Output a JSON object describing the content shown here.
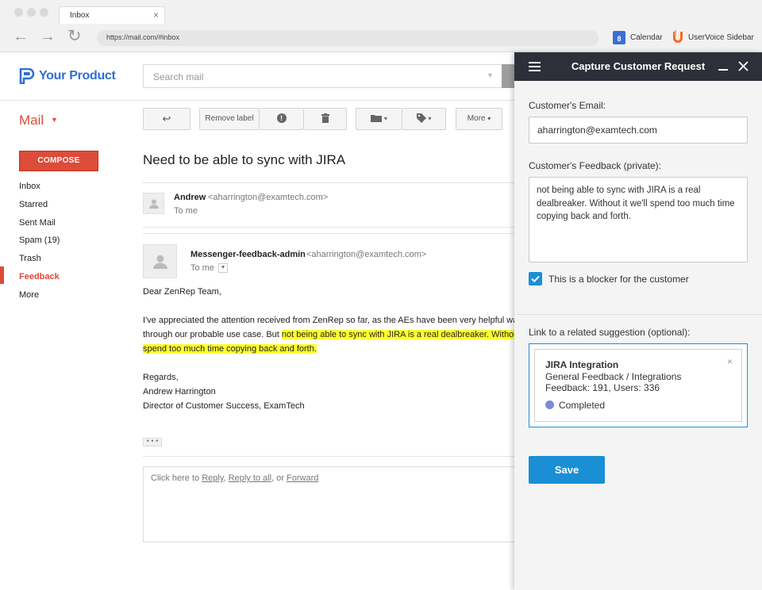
{
  "browser": {
    "tab_title": "Inbox",
    "tab_close": "×",
    "url": "https://mail.com/#inbox",
    "extensions": [
      {
        "label": "Calendar",
        "icon": "calendar-icon",
        "icon_text": "8"
      },
      {
        "label": "UserVoice Sidebar",
        "icon": "uservoice-icon"
      }
    ],
    "back_glyph": "←",
    "forward_glyph": "→",
    "reload_glyph": "↻"
  },
  "brand": {
    "name": "Your Product",
    "color": "#2f6fd1"
  },
  "search": {
    "placeholder": "Search mail"
  },
  "mail_menu": {
    "label": "Mail",
    "caret": "▼"
  },
  "toolbar": {
    "reply_glyph": "↩",
    "remove_label": "Remove label",
    "report_glyph": "!",
    "more_label": "More",
    "caret": "▾"
  },
  "sidebar": {
    "compose_label": "COMPOSE",
    "items": [
      {
        "label": "Inbox",
        "active": false
      },
      {
        "label": "Starred",
        "active": false
      },
      {
        "label": "Sent Mail",
        "active": false
      },
      {
        "label": "Spam (19)",
        "active": false
      },
      {
        "label": "Trash",
        "active": false
      },
      {
        "label": "Feedback",
        "active": true
      },
      {
        "label": "More",
        "active": false
      }
    ]
  },
  "thread": {
    "subject": "Need to be able to sync with JIRA",
    "messages": [
      {
        "sender_name": "Andrew",
        "sender_email": "<aharrington@examtech.com>",
        "to": "To me"
      },
      {
        "sender_name": "Messenger-feedback-admin",
        "sender_email": "<aharrington@examtech.com>",
        "to": "To me"
      }
    ],
    "body": {
      "greeting": "Dear ZenRep Team,",
      "line1": "I've appreciated the attention received from ZenRep so far, as the AEs have been very helpful walki",
      "line2_plain": "through our probable use case. But ",
      "line2_highlight": "not being able to sync with JIRA is a real dealbreaker. Without it",
      "line3_highlight": "spend too much time copying back and forth.",
      "signoff": "Regards,",
      "name": "Andrew Harrington",
      "title": "Director of Customer Success, ExamTech"
    },
    "ellipsis": "• • •",
    "reply": {
      "prefix": "Click here to ",
      "reply": "Reply",
      "sep1": ", ",
      "reply_all": "Reply to all",
      "sep2": ", or ",
      "forward": "Forward"
    },
    "highlight_color": "#ffff2e"
  },
  "panel": {
    "title": "Capture Customer Request",
    "email_label": "Customer's Email:",
    "email_value": "aharrington@examtech.com",
    "feedback_label": "Customer's Feedback (private):",
    "feedback_value": "not being able to sync with JIRA is a real dealbreaker. Without it we'll spend too much time copying back and forth.",
    "blocker_checked": true,
    "blocker_label": "This is a blocker for the customer",
    "suggestion_label": "Link to a related suggestion (optional):",
    "suggestion": {
      "title": "JIRA Integration",
      "category": "General Feedback / Integrations",
      "stats": "Feedback: 191, Users: 336",
      "status": "Completed",
      "remove": "×"
    },
    "save_label": "Save",
    "accent_color": "#1a8fd6",
    "header_color": "#2d3039"
  }
}
